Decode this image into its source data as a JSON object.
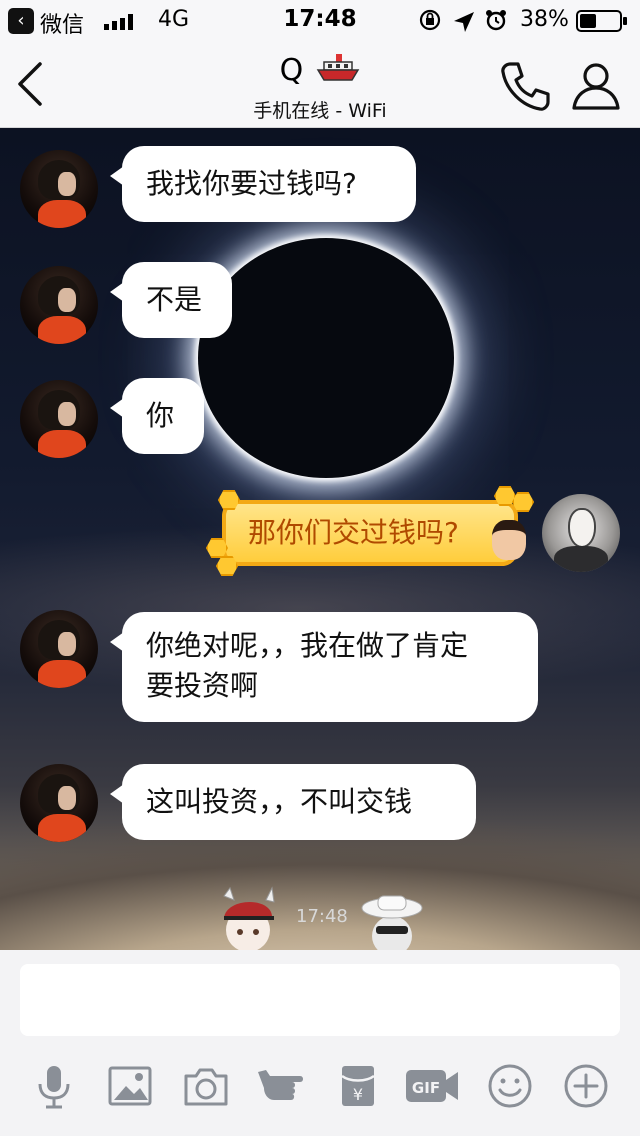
{
  "status_bar": {
    "back_app": "微信",
    "network": "4G",
    "time": "17:48",
    "battery": "38%"
  },
  "nav": {
    "title": "Q",
    "subtitle": "手机在线 - WiFi"
  },
  "messages": [
    {
      "side": "left",
      "text": "我找你要过钱吗?"
    },
    {
      "side": "left",
      "text": "不是"
    },
    {
      "side": "left",
      "text": "你"
    },
    {
      "side": "right",
      "text": "那你们交过钱吗?"
    },
    {
      "side": "left",
      "text_line1": "你绝对呢，，我在做了肯定",
      "text_line2": "要投资啊"
    },
    {
      "side": "left",
      "text": "这叫投资，，不叫交钱"
    }
  ],
  "bottom_time": "17:48",
  "input": {
    "value": "",
    "placeholder": ""
  },
  "toolbar": [
    {
      "icon": "microphone-icon"
    },
    {
      "icon": "image-icon"
    },
    {
      "icon": "camera-icon"
    },
    {
      "icon": "poke-hand-icon"
    },
    {
      "icon": "red-packet-icon"
    },
    {
      "icon": "gif-icon"
    },
    {
      "icon": "emoji-icon"
    },
    {
      "icon": "plus-icon"
    }
  ],
  "colors": {
    "self_bubble": "#ffcd3c",
    "self_text": "#b04a00",
    "toolbar_icon": "#8a8f97"
  }
}
